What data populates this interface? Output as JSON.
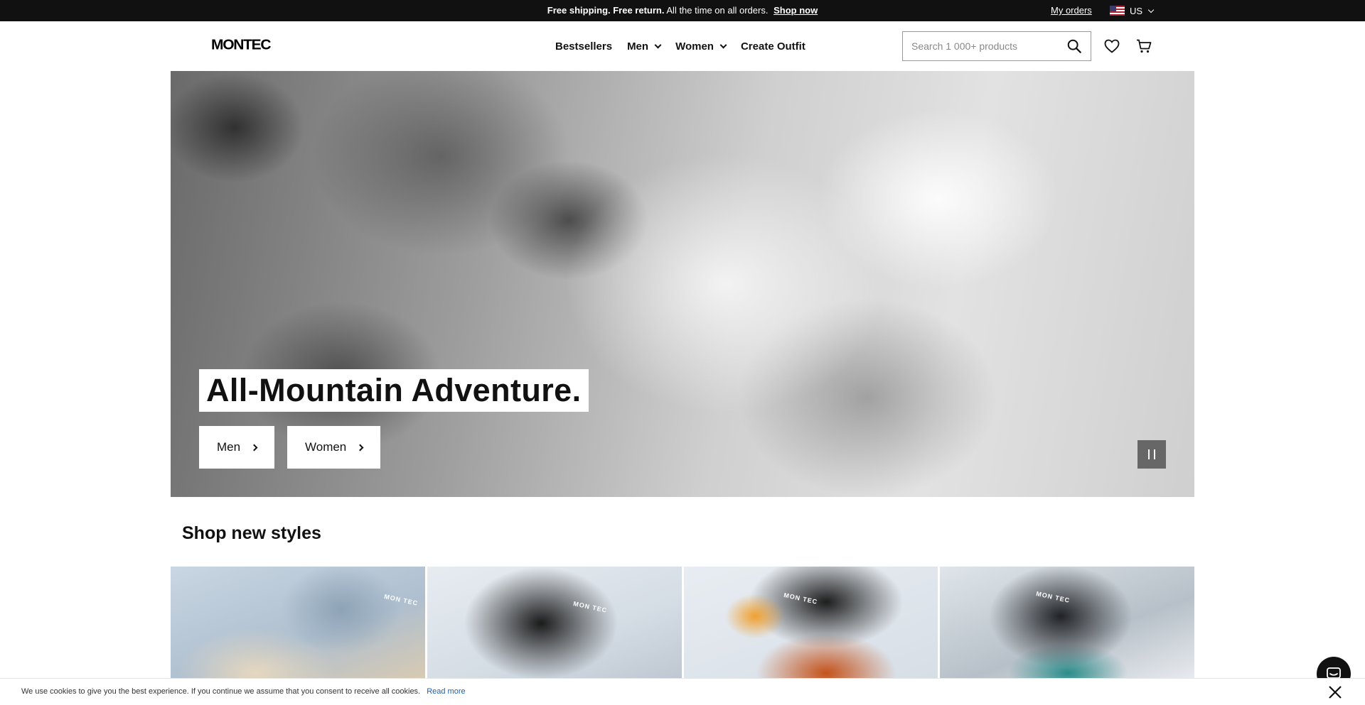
{
  "topbar": {
    "bold_text": "Free shipping. Free return.",
    "text": "All the time on all orders.",
    "link": "Shop now",
    "orders": "My orders",
    "locale": "US"
  },
  "header": {
    "logo": "MONTEC",
    "nav": [
      "Bestsellers",
      "Men",
      "Women",
      "Create Outfit"
    ],
    "search_placeholder": "Search 1 000+ products",
    "icons": [
      "search-icon",
      "heart-icon",
      "cart-icon"
    ]
  },
  "hero": {
    "title": "All-Mountain Adventure.",
    "cta_men": "Men",
    "cta_women": "Women"
  },
  "section": {
    "title": "Shop new styles",
    "tile_brand": "MON TEC"
  },
  "cookie": {
    "text": "We use cookies to give you the best experience. If you continue we assume that you consent to receive all cookies.",
    "link": "Read more"
  },
  "colors": {
    "topbar_bg": "#111111",
    "link_blue": "#1a5fb4"
  }
}
